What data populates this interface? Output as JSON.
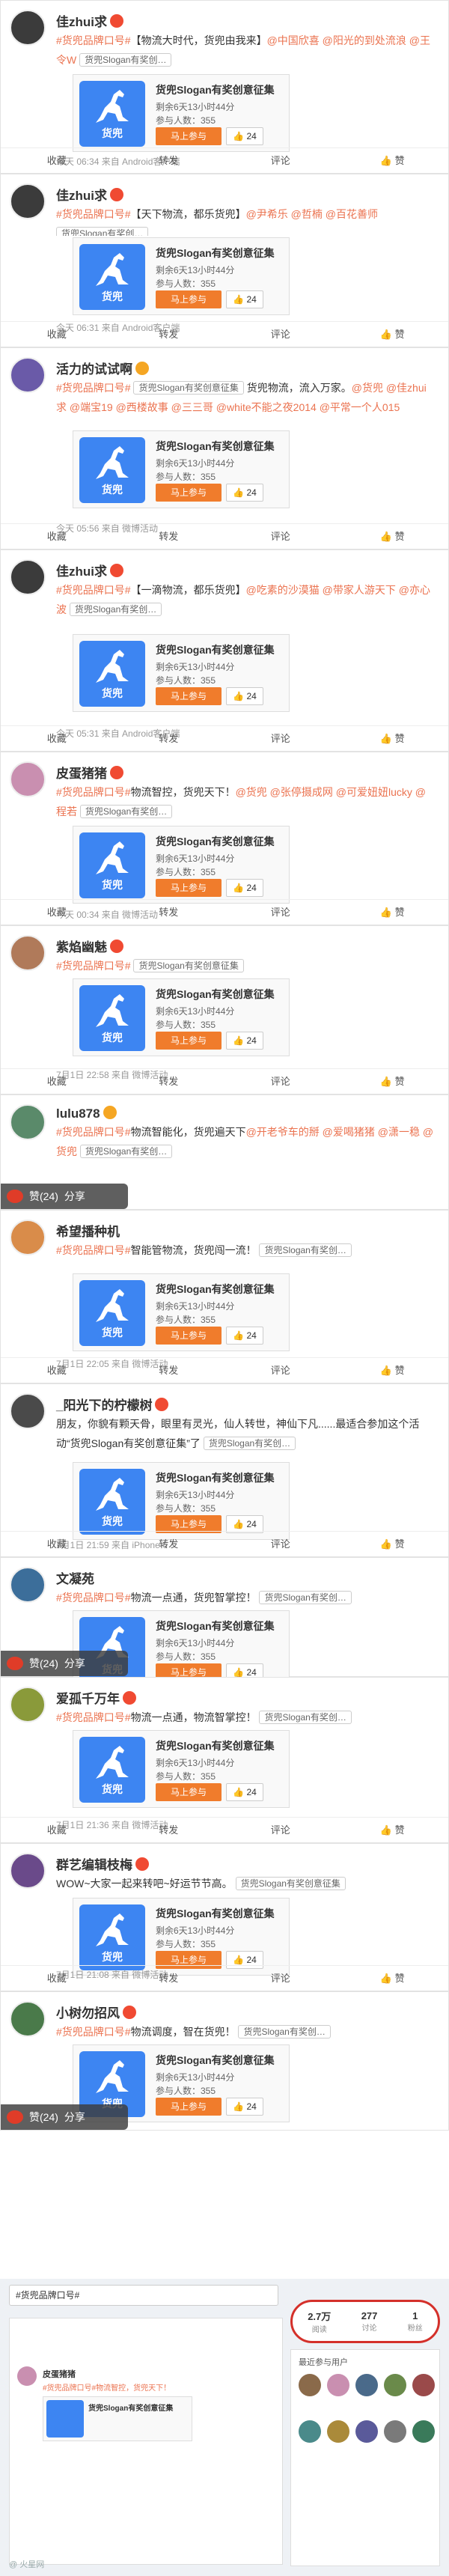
{
  "poll": {
    "title": "货兜Slogan有奖创意征集",
    "remaining": "剩余6天13小时44分",
    "participants": "参与人数：355",
    "join_label": "马上参与",
    "like_count": "24",
    "logo_text": "货兜"
  },
  "actions": {
    "collect": "收藏",
    "forward": "转发",
    "comment": "评论",
    "like": "赞"
  },
  "overlay": {
    "like": "赞",
    "count": "(24)",
    "share": "分享"
  },
  "posts": [
    {
      "user": "佳zhui求",
      "badge": "red",
      "text": [
        {
          "t": "#货兜品牌口号#",
          "c": "tag"
        },
        {
          "t": "【物流大时代，货兜由我来】"
        },
        {
          "t": "@中国欣喜 @阳光的到处流浪 @王令W",
          "c": "at"
        },
        {
          "t": " "
        },
        {
          "t": "货兜Slogan有奖创…",
          "c": "chip"
        }
      ],
      "meta": "今天 06:34 来自 Android客户端",
      "actions": "full",
      "avatar": "#3b3b3b"
    },
    {
      "user": "佳zhui求",
      "badge": "red",
      "text": [
        {
          "t": "#货兜品牌口号#",
          "c": "tag"
        },
        {
          "t": "【天下物流，都乐货兜】"
        },
        {
          "t": "@尹希乐 @哲楠 @百花善师",
          "c": "at"
        },
        {
          "t": " "
        },
        {
          "t": "货兜Slogan有奖创…",
          "c": "chip"
        }
      ],
      "meta": "今天 06:31 来自 Android客户端",
      "actions": "full",
      "avatar": "#3b3b3b"
    },
    {
      "user": "活力的试试啊",
      "badge": "gold",
      "text": [
        {
          "t": "#货兜品牌口号#",
          "c": "tag"
        },
        {
          "t": " "
        },
        {
          "t": "货兜Slogan有奖创意征集",
          "c": "chip"
        },
        {
          "t": " 货兜物流，流入万家。"
        },
        {
          "t": "@货兜 @佳zhui求 @端宝19 @西楼故事 @三三哥 @white不能之夜2014 @平常一个人015",
          "c": "at"
        }
      ],
      "meta": "今天 05:56 来自 微博活动",
      "actions": "full",
      "avatar": "#6a5aa8"
    },
    {
      "user": "佳zhui求",
      "badge": "red",
      "text": [
        {
          "t": "#货兜品牌口号#",
          "c": "tag"
        },
        {
          "t": "【一滴物流，都乐货兜】"
        },
        {
          "t": "@吃素的沙漠猫 @带家人游天下 @亦心波",
          "c": "at"
        },
        {
          "t": " "
        },
        {
          "t": "货兜Slogan有奖创…",
          "c": "chip"
        }
      ],
      "meta": "今天 05:31 来自 Android客户端",
      "actions": "full",
      "avatar": "#3b3b3b"
    },
    {
      "user": "皮蛋猪猪",
      "badge": "red",
      "text": [
        {
          "t": "#货兜品牌口号#",
          "c": "tag"
        },
        {
          "t": "物流智控，货兜天下！"
        },
        {
          "t": "@货兜 @张停摄成网 @可爱妞妞lucky @程若",
          "c": "at"
        },
        {
          "t": " "
        },
        {
          "t": "货兜Slogan有奖创…",
          "c": "chip"
        }
      ],
      "meta": "今天 00:34 来自 微博活动",
      "actions": "full",
      "avatar": "#c98fb0"
    },
    {
      "user": "紫焰幽魅",
      "badge": "red",
      "text": [
        {
          "t": "#货兜品牌口号#",
          "c": "tag"
        },
        {
          "t": " "
        },
        {
          "t": "货兜Slogan有奖创意征集",
          "c": "chip"
        }
      ],
      "meta": "7月1日 22:58 来自 微博活动",
      "actions": "full",
      "avatar": "#b07a5a"
    },
    {
      "user": "lulu878",
      "badge": "gold",
      "text": [
        {
          "t": "#货兜品牌口号#",
          "c": "tag"
        },
        {
          "t": "物流智能化，货兜遍天下"
        },
        {
          "t": "@开老爷车的掰 @爱喝猪猪 @潇一稳 @货兜",
          "c": "at"
        },
        {
          "t": " "
        },
        {
          "t": "货兜Slogan有奖创…",
          "c": "chip"
        }
      ],
      "meta": "",
      "actions": "overlay",
      "avatar": "#5a8a6a"
    },
    {
      "user": "希望播种机",
      "badge": "",
      "text": [
        {
          "t": "#货兜品牌口号#",
          "c": "tag"
        },
        {
          "t": "智能管物流，货兜闯一流！"
        },
        {
          "t": " "
        },
        {
          "t": "货兜Slogan有奖创…",
          "c": "chip"
        }
      ],
      "meta": "7月1日 22:05 来自 微博活动",
      "actions": "full",
      "avatar": "#d98c4a"
    },
    {
      "user": "_阳光下的柠檬树",
      "badge": "red",
      "text": [
        {
          "t": "朋友，你貌有颗天骨，眼里有灵光，仙人转世，神仙下凡......最适合参加这个活动“货兜Slogan有奖创意征集”了 "
        },
        {
          "t": "货兜Slogan有奖创…",
          "c": "chip"
        }
      ],
      "meta": "7月1日 21:59 来自 iPhone 6",
      "actions": "full",
      "avatar": "#4a4a4a"
    },
    {
      "user": "文凝苑",
      "badge": "",
      "text": [
        {
          "t": "#货兜品牌口号#",
          "c": "tag"
        },
        {
          "t": "物流一点通，货兜智掌控！"
        },
        {
          "t": " "
        },
        {
          "t": "货兜Slogan有奖创…",
          "c": "chip"
        }
      ],
      "meta": "",
      "actions": "overlay",
      "avatar": "#3c6e9a"
    },
    {
      "user": "爱孤千万年",
      "badge": "red",
      "text": [
        {
          "t": "#货兜品牌口号#",
          "c": "tag"
        },
        {
          "t": "物流一点通，物流智掌控！"
        },
        {
          "t": " "
        },
        {
          "t": "货兜Slogan有奖创…",
          "c": "chip"
        }
      ],
      "meta": "7月1日 21:36 来自 微博活动",
      "actions": "full",
      "avatar": "#8a9a3a"
    },
    {
      "user": "群艺编辑枝梅",
      "badge": "red",
      "text": [
        {
          "t": "WOW~大家一起来转吧~好运节节高。"
        },
        {
          "t": " "
        },
        {
          "t": "货兜Slogan有奖创意征集",
          "c": "chip"
        }
      ],
      "meta": "7月1日 21:08 来自 微博活动",
      "actions": "full",
      "avatar": "#6a4a8a"
    },
    {
      "user": "小树勿招风",
      "badge": "red",
      "text": [
        {
          "t": "#货兜品牌口号#",
          "c": "tag"
        },
        {
          "t": "物流调度，智在货兜！"
        },
        {
          "t": " "
        },
        {
          "t": "货兜Slogan有奖创…",
          "c": "chip"
        }
      ],
      "meta": "",
      "actions": "overlay",
      "avatar": "#4a7a4a"
    }
  ],
  "bottom": {
    "search_text": "#货兜品牌口号#",
    "stats": [
      {
        "n": "2.7万",
        "l": "阅读"
      },
      {
        "n": "277",
        "l": "讨论"
      },
      {
        "n": "1",
        "l": "粉丝"
      }
    ],
    "side_header": "最近参与用户",
    "small_user": "皮蛋猪猪",
    "small_text": "#货兜品牌口号#物流智控，货兜天下！",
    "watermark": "@ 火星网"
  },
  "colors": {
    "accent": "#eb7350",
    "join": "#f07c2c",
    "logo": "#3d85f2",
    "stats_ring": "#d4302a"
  }
}
